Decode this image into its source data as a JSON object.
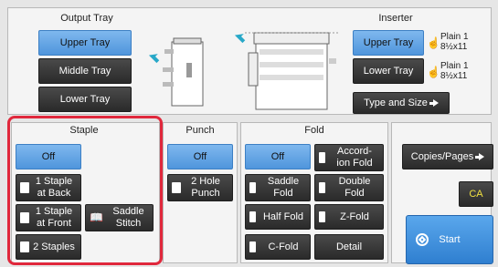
{
  "output_tray": {
    "title": "Output Tray",
    "upper": "Upper Tray",
    "middle": "Middle Tray",
    "lower": "Lower Tray"
  },
  "inserter": {
    "title": "Inserter",
    "upper": "Upper Tray",
    "lower": "Lower Tray",
    "upper_paper_type": "Plain 1",
    "upper_paper_size": "8½x11",
    "lower_paper_type": "Plain 1",
    "lower_paper_size": "8½x11",
    "type_and_size": "Type and Size"
  },
  "staple": {
    "title": "Staple",
    "off": "Off",
    "one_back_line1": "1 Staple",
    "one_back_line2": "at Back",
    "one_front_line1": "1 Staple",
    "one_front_line2": "at Front",
    "saddle_line1": "Saddle",
    "saddle_line2": "Stitch",
    "two": "2 Staples"
  },
  "punch": {
    "title": "Punch",
    "off": "Off",
    "two_hole_line1": "2 Hole",
    "two_hole_line2": "Punch"
  },
  "fold": {
    "title": "Fold",
    "off": "Off",
    "accordion_line1": "Accord-",
    "accordion_line2": "ion Fold",
    "saddle_line1": "Saddle",
    "saddle_line2": "Fold",
    "double_line1": "Double",
    "double_line2": "Fold",
    "half": "Half Fold",
    "z": "Z-Fold",
    "c": "C-Fold",
    "detail": "Detail"
  },
  "right": {
    "copies_pages": "Copies/Pages",
    "ca": "CA",
    "start": "Start"
  },
  "colors": {
    "selected": "#5b9fe0",
    "dark_button": "#333333",
    "highlight": "#e0283c"
  }
}
